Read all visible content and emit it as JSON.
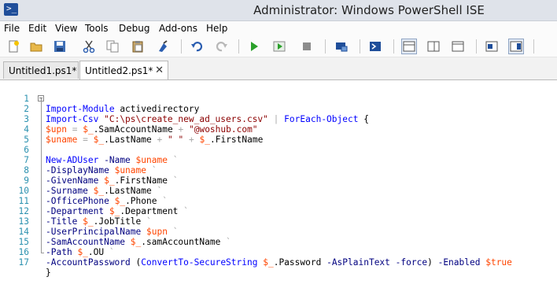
{
  "window": {
    "title": "Administrator: Windows PowerShell ISE",
    "app_icon": "powershell-icon"
  },
  "menu": [
    "File",
    "Edit",
    "View",
    "Tools",
    "Debug",
    "Add-ons",
    "Help"
  ],
  "toolbar_icons": [
    "new-file-icon",
    "open-folder-icon",
    "save-icon",
    "cut-icon",
    "copy-icon",
    "paste-icon",
    "clear-console-icon",
    "undo-icon",
    "redo-icon",
    "run-script-icon",
    "run-selection-icon",
    "stop-icon",
    "remote-powershell-icon",
    "start-powershell-icon",
    "show-script-pane-top-icon",
    "show-script-pane-right-icon",
    "show-script-pane-maximized-icon",
    "show-command-window-icon",
    "show-command-addon-icon"
  ],
  "tabs": [
    {
      "label": "Untitled1.ps1*",
      "active": false
    },
    {
      "label": "Untitled2.ps1*",
      "active": true,
      "close": "✕"
    }
  ],
  "editor": {
    "line_numbers": [
      "1",
      "2",
      "3",
      "4",
      "5",
      "6",
      "7",
      "8",
      "9",
      "10",
      "11",
      "12",
      "13",
      "14",
      "15",
      "16",
      "17"
    ],
    "fold_marker": "−"
  },
  "colors": {
    "keyword": "#0000ff",
    "string": "#8b0000",
    "variable": "#ff4500",
    "line_number": "#2b91af",
    "operator": "#a9a9a9"
  }
}
